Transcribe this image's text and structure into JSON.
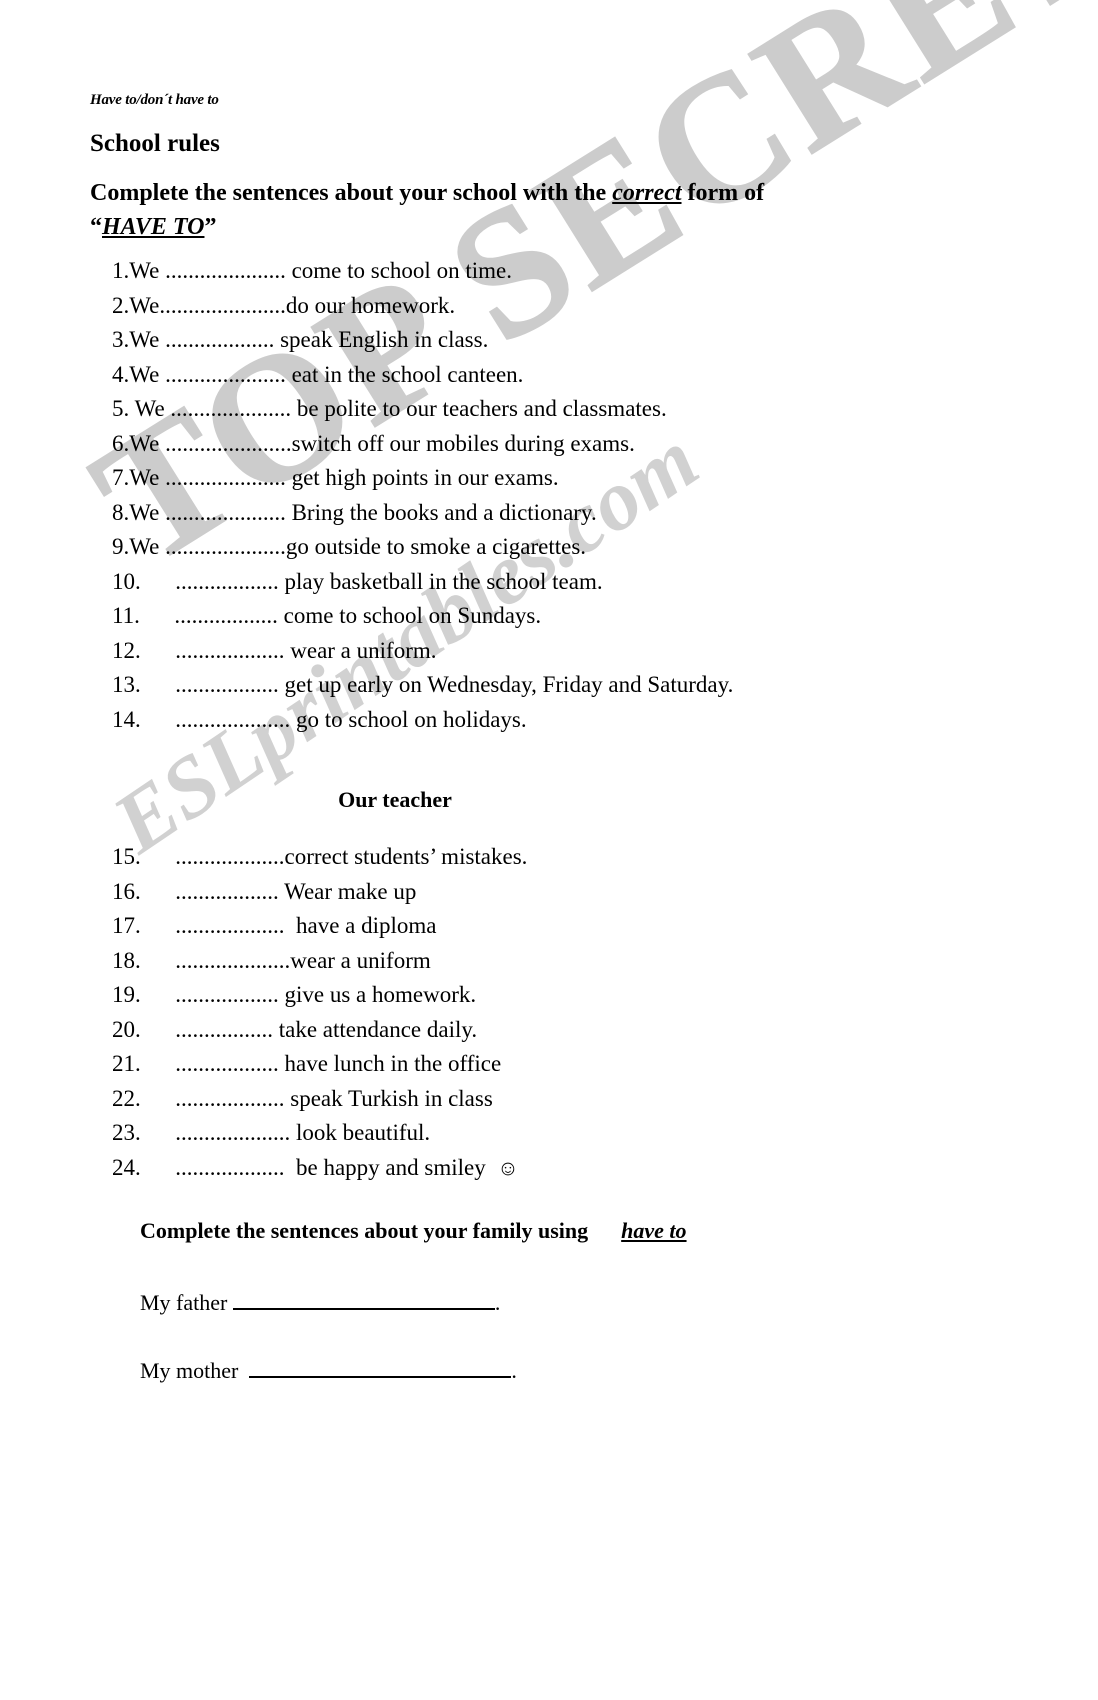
{
  "header": {
    "kicker": "Have to/don´t have to",
    "title": "School rules",
    "instruction_part1": "Complete the sentences about your school with the ",
    "instruction_emphasis": "correct",
    "instruction_part2": " form of",
    "instruction_line2_quote_open": "“",
    "instruction_line2_haveto": "HAVE TO",
    "instruction_line2_quote_close": "”"
  },
  "school_rules": {
    "items": [
      {
        "num": "1.",
        "subject": "We",
        "blank": " ..................... ",
        "text": "come to school on time."
      },
      {
        "num": "2.",
        "subject": "We",
        "blank": "......................",
        "text": "do our homework."
      },
      {
        "num": "3.",
        "subject": "We",
        "blank": " ................... ",
        "text": "speak English in class."
      },
      {
        "num": "4.",
        "subject": "We",
        "blank": " ..................... ",
        "text": "eat in the school canteen."
      },
      {
        "num": "5.",
        "subject": " We",
        "blank": " ..................... ",
        "text": "be polite to our teachers and classmates."
      },
      {
        "num": "6.",
        "subject": "We",
        "blank": " ......................",
        "text": "switch off our mobiles during exams."
      },
      {
        "num": "7.",
        "subject": "We",
        "blank": " ..................... ",
        "text": "get high points in our exams."
      },
      {
        "num": "8.",
        "subject": "We",
        "blank": " ..................... ",
        "text": "Bring the books and a dictionary."
      },
      {
        "num": "9.",
        "subject": "We",
        "blank": " .....................",
        "text": "go outside to smoke a cigarettes."
      },
      {
        "num": "10.",
        "subject": "",
        "blank": "      .................. ",
        "text": "play basketball in the school team."
      },
      {
        "num": "11.",
        "subject": "",
        "blank": "      .................. ",
        "text": "come to school on Sundays."
      },
      {
        "num": "12.",
        "subject": "",
        "blank": "      ................... ",
        "text": "wear a uniform."
      },
      {
        "num": "13.",
        "subject": "",
        "blank": "      .................. ",
        "text": "get up early on Wednesday, Friday and Saturday."
      },
      {
        "num": "14.",
        "subject": "",
        "blank": "      .................... ",
        "text": "go to school on holidays."
      }
    ]
  },
  "teacher_section": {
    "heading": "Our teacher",
    "items": [
      {
        "num": "15.",
        "blank": "      ...................",
        "text": "correct students’ mistakes."
      },
      {
        "num": "16.",
        "blank": "      .................. ",
        "text": "Wear make up"
      },
      {
        "num": "17.",
        "blank": "      ................... ",
        "text": " have a diploma"
      },
      {
        "num": "18.",
        "blank": "      ....................",
        "text": "wear a uniform"
      },
      {
        "num": "19.",
        "blank": "      .................. ",
        "text": "give us a homework."
      },
      {
        "num": "20.",
        "blank": "      ................. ",
        "text": "take attendance daily."
      },
      {
        "num": "21.",
        "blank": "      .................. ",
        "text": "have lunch in the office"
      },
      {
        "num": "22.",
        "blank": "      ................... ",
        "text": "speak Turkish in class"
      },
      {
        "num": "23.",
        "blank": "      .................... ",
        "text": "look beautiful."
      },
      {
        "num": "24.",
        "blank": "      ................... ",
        "text": " be happy and smiley  ",
        "smiley": "☺"
      }
    ]
  },
  "family_section": {
    "instruction": "Complete the sentences about your family using      ",
    "instruction_haveto": "have to",
    "father_label": "My father ",
    "father_end": ".",
    "mother_label": "My mother  ",
    "mother_end": "."
  },
  "watermarks": {
    "top_secret": "TOP SECRET",
    "site": "ESLprintables.com",
    "color": "#c0c0c0"
  }
}
